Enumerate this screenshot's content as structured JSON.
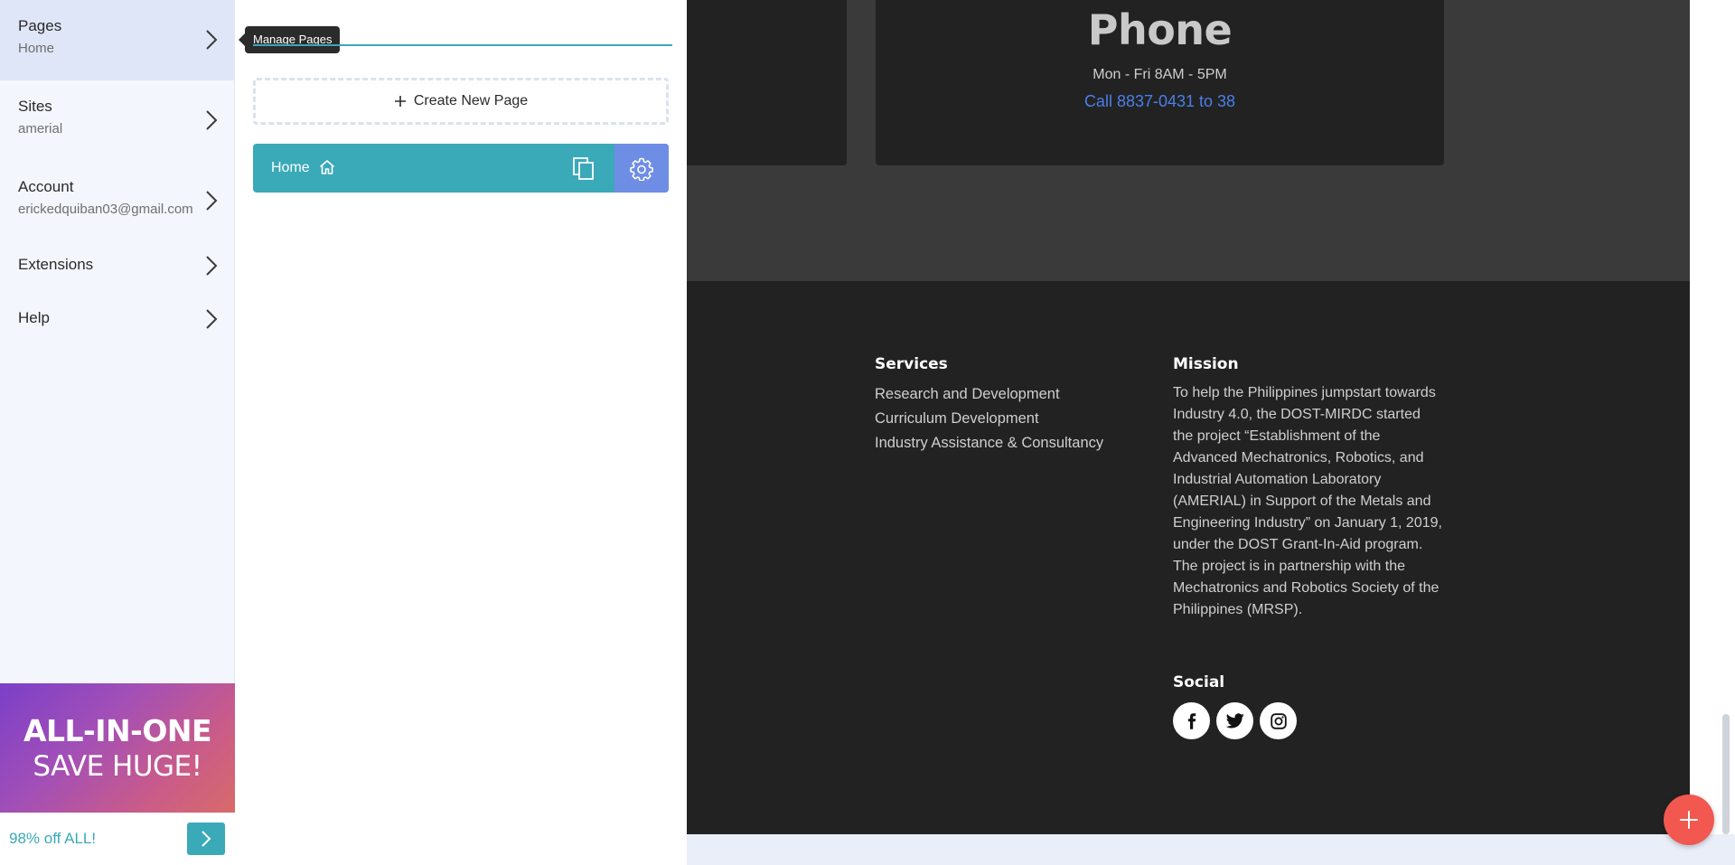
{
  "sidebar": {
    "items": [
      {
        "label": "Pages",
        "sub": "Home"
      },
      {
        "label": "Sites",
        "sub": "amerial"
      },
      {
        "label": "Account",
        "sub": "erickedquiban03@gmail.com"
      },
      {
        "label": "Extensions"
      },
      {
        "label": "Help"
      }
    ],
    "promo": {
      "line1": "ALL-IN-ONE",
      "line2": "SAVE HUGE!",
      "bar_text": "98% off ALL!"
    }
  },
  "panel": {
    "tooltip": "Manage Pages",
    "create_label": "Create New Page",
    "pages": [
      {
        "name": "Home"
      }
    ]
  },
  "site": {
    "phone": {
      "title": "Phone",
      "hours": "Mon - Fri 8AM - 5PM",
      "link": "Call 8837-0431 to 38"
    },
    "services": {
      "heading": "Services",
      "items": [
        "Research and Development",
        "Curriculum Development",
        "Industry Assistance & Consultancy"
      ]
    },
    "mission": {
      "heading": "Mission",
      "text": "To help the Philippines jumpstart towards Industry 4.0, the DOST-MIRDC started the project “Establishment of the Advanced Mechatronics, Robotics, and Industrial Automation Laboratory (AMERIAL) in Support of the Metals and Engineering Industry” on January 1, 2019, under the DOST Grant-In-Aid program. The project is in partnership with the Mechatronics and Robotics Society of the Philippines (MRSP)."
    },
    "social": {
      "heading": "Social",
      "icons": [
        "facebook-icon",
        "twitter-icon",
        "instagram-icon"
      ]
    }
  },
  "colors": {
    "accent_teal": "#3aa9b8",
    "settings_blue": "#6e8de4",
    "fab_red": "#f2584f",
    "link_blue": "#4a7fe8",
    "footer_dark": "#222222"
  }
}
